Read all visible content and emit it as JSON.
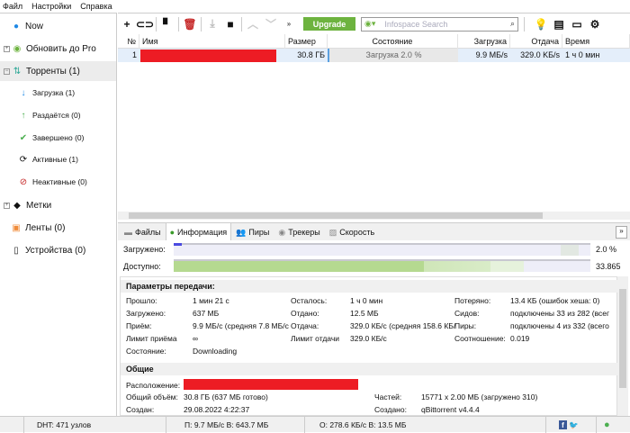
{
  "menu": [
    "Файл",
    "Настройки",
    "Справка"
  ],
  "sidebar": {
    "items": [
      {
        "label": "Now",
        "icon": "now-icon"
      },
      {
        "label": "Обновить до Pro",
        "icon": "utorrent-icon"
      },
      {
        "label": "Торренты (1)",
        "icon": "torrents-icon"
      },
      {
        "label": "Загрузка (1)",
        "icon": "download-arrow-icon"
      },
      {
        "label": "Раздаётся (0)",
        "icon": "upload-arrow-icon"
      },
      {
        "label": "Завершено (0)",
        "icon": "check-icon"
      },
      {
        "label": "Активные (1)",
        "icon": "refresh-icon"
      },
      {
        "label": "Неактивные (0)",
        "icon": "inactive-icon"
      },
      {
        "label": "Метки",
        "icon": "tag-icon"
      },
      {
        "label": "Ленты (0)",
        "icon": "rss-icon"
      },
      {
        "label": "Устройства (0)",
        "icon": "device-icon"
      }
    ]
  },
  "toolbar": {
    "upgrade": "Upgrade",
    "search_placeholder": "Infospace Search"
  },
  "table": {
    "headers": [
      "№",
      "Имя",
      "Размер",
      "Состояние",
      "Загрузка",
      "Отдача",
      "Время"
    ],
    "rows": [
      {
        "num": "1",
        "name": "",
        "size": "30.8 ГБ",
        "status": "Загрузка 2.0 %",
        "down": "9.9 МБ/s",
        "up": "329.0 KБ/s",
        "time": "1 ч 0 мин"
      }
    ]
  },
  "tabs": [
    "Файлы",
    "Информация",
    "Пиры",
    "Трекеры",
    "Скорость"
  ],
  "progress": {
    "downloaded_label": "Загружено:",
    "downloaded_value": "2.0 %",
    "downloaded_fraction": 0.02,
    "available_label": "Доступно:",
    "available_value": "33.865"
  },
  "transfer": {
    "title": "Параметры передачи:",
    "rows": [
      [
        "Прошло:",
        "1 мин 21 с",
        "Осталось:",
        "1 ч 0 мин",
        "Потеряно:",
        "13.4 КБ (ошибок хеша: 0)"
      ],
      [
        "Загружено:",
        "637 МБ",
        "Отдано:",
        "12.5 МБ",
        "Сидов:",
        "подключены 33 из 282 (всег"
      ],
      [
        "Приём:",
        "9.9 МБ/с (средняя 7.8 МБ/с",
        "Отдача:",
        "329.0 КБ/с (средняя 158.6 КБ/",
        "Пиры:",
        "подключены 4 из 332 (всего"
      ],
      [
        "Лимит приёма",
        "∞",
        "Лимит отдачи",
        "329.0 КБ/с",
        "Соотношение:",
        "0.019"
      ],
      [
        "Состояние:",
        "Downloading",
        "",
        "",
        "",
        ""
      ]
    ]
  },
  "general": {
    "title": "Общие",
    "location_label": "Расположение:",
    "total_label": "Общий объём:",
    "total_value": "30.8 ГБ (637 МБ готово)",
    "created_label": "Создан:",
    "created_value": "29.08.2022 4:22:37",
    "pieces_label": "Частей:",
    "pieces_value": "15771 x 2.00 МБ (загружено 310)",
    "createdby_label": "Создано:",
    "createdby_value": "qBittorrent v4.4.4"
  },
  "status": {
    "dht": "DHT: 471 узлов",
    "down": "П: 9.7 МБ/с В: 643.7 МБ",
    "up": "О: 278.6 КБ/с В: 13.5 МБ"
  }
}
